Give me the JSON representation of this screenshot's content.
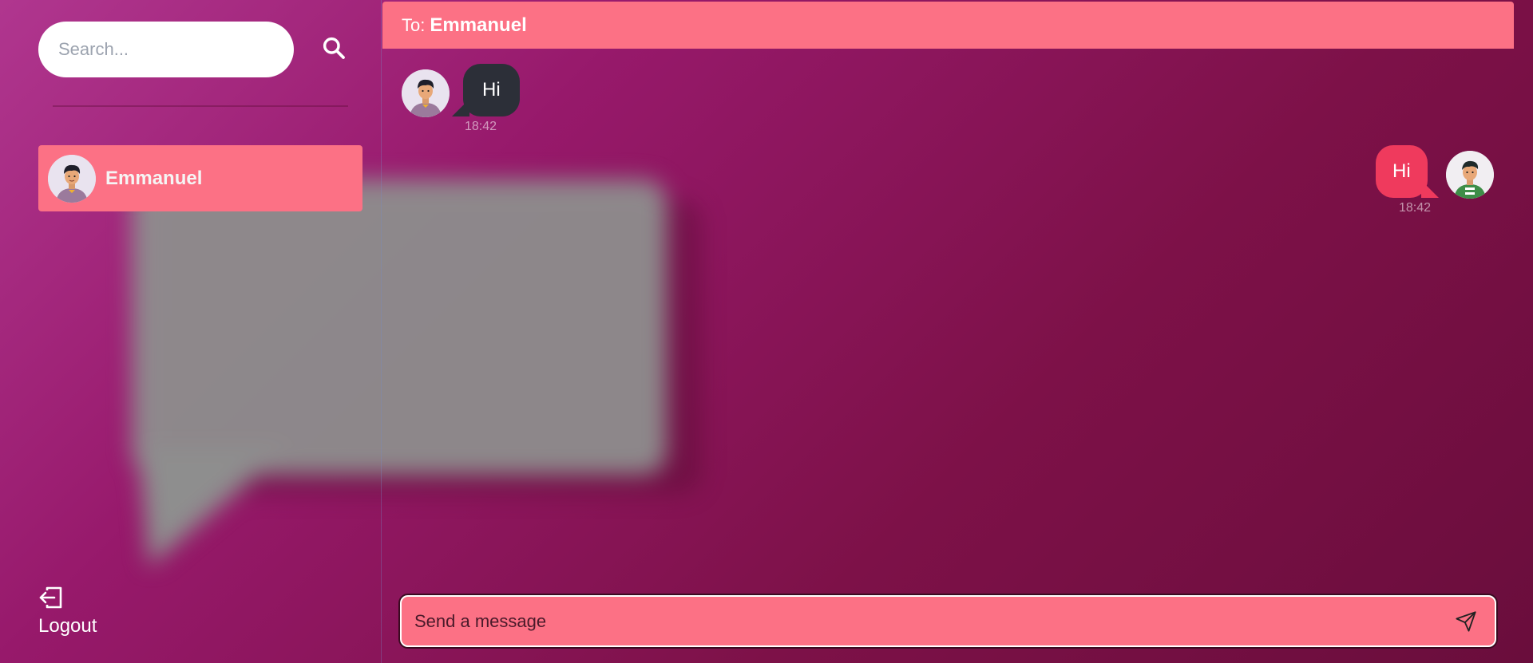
{
  "sidebar": {
    "search": {
      "placeholder": "Search...",
      "value": "",
      "icon": "search-icon"
    },
    "conversations": [
      {
        "name": "Emmanuel",
        "selected": true,
        "avatar": "male-avatar-purple-shirt"
      }
    ],
    "logout": {
      "label": "Logout",
      "icon": "logout-icon"
    }
  },
  "chat": {
    "header": {
      "prefix": "To:",
      "recipient": "Emmanuel"
    },
    "messages": [
      {
        "side": "incoming",
        "text": "Hi",
        "time": "18:42",
        "avatar": "male-avatar-purple-shirt"
      },
      {
        "side": "outgoing",
        "text": "Hi",
        "time": "18:42",
        "avatar": "male-avatar-green-striped-shirt"
      }
    ],
    "composer": {
      "placeholder": "Send a message",
      "value": "",
      "send_icon": "send-icon"
    }
  },
  "colors": {
    "accent_pink": "#fc7185",
    "outgoing_bubble": "#ef3a5d",
    "incoming_bubble": "#2c2f38",
    "background_start": "#b0368f",
    "background_end": "#6a0d3c"
  }
}
